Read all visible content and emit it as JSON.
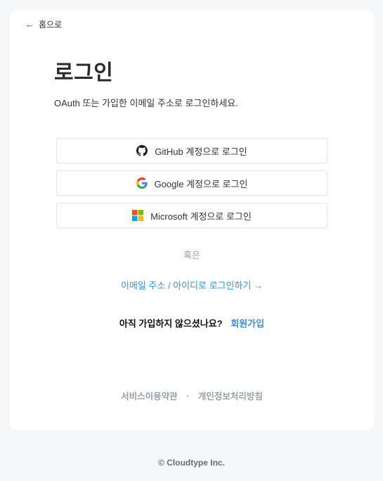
{
  "nav": {
    "arrow": "←",
    "home_label": "홈으로"
  },
  "header": {
    "title": "로그인",
    "subtitle": "OAuth 또는 가입한 이메일 주소로 로그인하세요."
  },
  "oauth": {
    "github_label": "GitHub 계정으로 로그인",
    "google_label": "Google 계정으로 로그인",
    "microsoft_label": "Microsoft 계정으로 로그인"
  },
  "divider": {
    "or_label": "혹은"
  },
  "email_login": {
    "label": "이메일 주소 / 아이디로 로그인하기",
    "arrow": "→"
  },
  "signup": {
    "question": "아직 가입하지 않으셨나요?",
    "link": "회원가입"
  },
  "footer": {
    "terms": "서비스이용약관",
    "separator": "·",
    "privacy": "개인정보처리방침",
    "copyright": "© Cloudtype Inc."
  },
  "colors": {
    "page_bg": "#f6f7f9",
    "card_bg": "#ffffff",
    "link_blue": "#3b8fd6",
    "muted_gray": "#9aa0a8"
  },
  "icons": {
    "github": "github-icon",
    "google": "google-icon",
    "microsoft": "microsoft-icon"
  }
}
